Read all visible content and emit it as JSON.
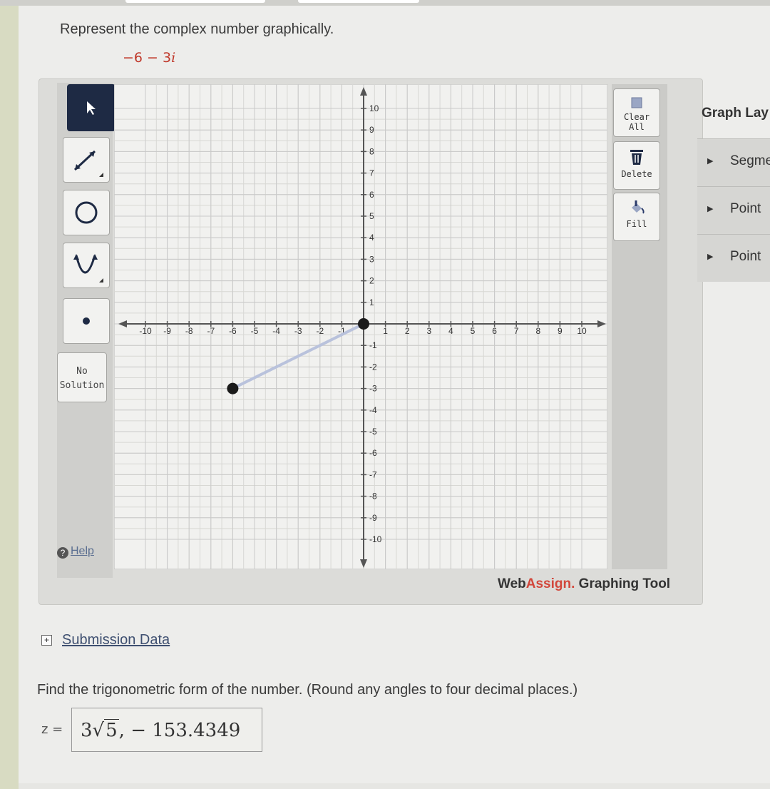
{
  "question": {
    "text": "Represent the complex number graphically.",
    "expression": "−6 − 3",
    "expression_i": "i"
  },
  "tools": {
    "no_solution_line1": "No",
    "no_solution_line2": "Solution",
    "help_label": "Help",
    "help_icon": "?"
  },
  "actions": {
    "clear_all": "Clear All",
    "delete": "Delete",
    "fill": "Fill"
  },
  "layers": {
    "title": "Graph Lay",
    "items": [
      "Segme",
      "Point",
      "Point"
    ]
  },
  "brand": {
    "web": "Web",
    "assign": "Assign.",
    "rest": " Graphing Tool"
  },
  "submission": {
    "label": "Submission Data"
  },
  "find": {
    "text": "Find the trigonometric form of the number. (Round any angles to four decimal places.)"
  },
  "answer": {
    "z_label": "z =",
    "coef": "3",
    "radicand": "5",
    "rest": ", − 153.4349"
  },
  "chart_data": {
    "type": "scatter",
    "xlim": [
      -10,
      10
    ],
    "ylim": [
      -10,
      10
    ],
    "grid": true,
    "x_ticks": [
      "-10",
      "-9",
      "-8",
      "-7",
      "-6",
      "-5",
      "-4",
      "-3",
      "-2",
      "-1",
      "1",
      "2",
      "3",
      "4",
      "5",
      "6",
      "7",
      "8",
      "9",
      "10"
    ],
    "y_ticks": [
      "10",
      "9",
      "8",
      "7",
      "6",
      "5",
      "4",
      "3",
      "2",
      "1",
      "-1",
      "-2",
      "-3",
      "-4",
      "-5",
      "-6",
      "-7",
      "-8",
      "-9",
      "-10"
    ],
    "points": [
      {
        "x": 0,
        "y": 0
      },
      {
        "x": -6,
        "y": -3
      }
    ],
    "segments": [
      {
        "x1": 0,
        "y1": 0,
        "x2": -6,
        "y2": -3
      }
    ],
    "colors": {
      "point": "#1a1a1a",
      "segment": "#b9c2dc",
      "axis": "#555555",
      "grid": "#c9c9c9"
    }
  }
}
